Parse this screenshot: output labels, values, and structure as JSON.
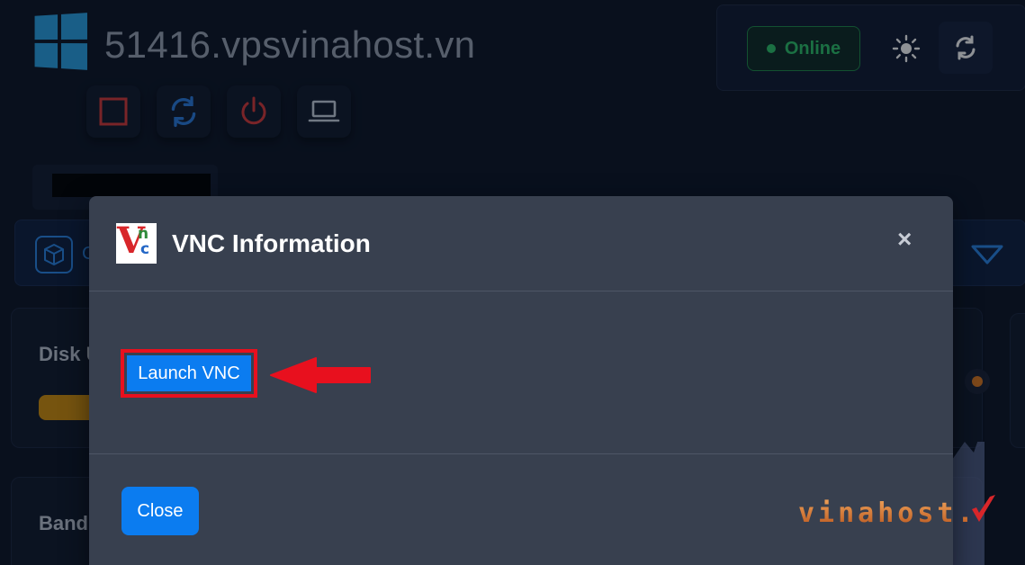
{
  "header": {
    "hostname": "51416.vpsvinahost.vn",
    "status": "Online",
    "icons": [
      "windows-logo-icon",
      "sun-icon",
      "refresh-icon"
    ]
  },
  "actions": [
    {
      "name": "stop-icon",
      "color": "#d93a3a"
    },
    {
      "name": "restart-icon",
      "color": "#2b7de0"
    },
    {
      "name": "power-icon",
      "color": "#d93a3a"
    },
    {
      "name": "laptop-icon",
      "color": "#c9d1de"
    }
  ],
  "info_bar": {
    "visible_letter": "C"
  },
  "cards": {
    "disk_title": "Disk U",
    "bandwidth_title": "Band"
  },
  "modal": {
    "title": "VNC Information",
    "launch_label": "Launch VNC",
    "close_label": "Close",
    "close_icon": "×"
  },
  "watermark": {
    "text": "vinahost."
  },
  "colors": {
    "accent": "#0b7cf0",
    "highlight": "#e8101e",
    "online": "#2ec46a",
    "disk_bar": "#d4900c"
  }
}
